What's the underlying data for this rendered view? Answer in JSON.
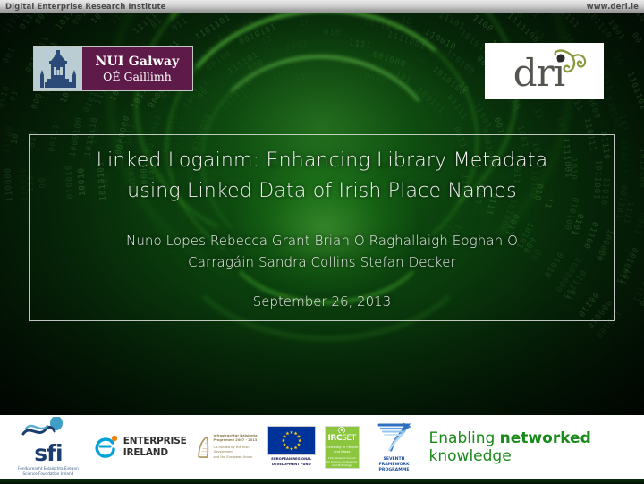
{
  "topbar": {
    "left_text": "Digital Enterprise Research Institute",
    "right_text": "www.deri.ie"
  },
  "logos": {
    "nui_galway": {
      "name": "NUI Galway",
      "line1": "NUI Galway",
      "line2": "OÉ Gaillimh",
      "icon": "quadrangle-tower-icon",
      "crest_bg": "#b9cdd3",
      "wordmark_bg": "#5e1a48"
    },
    "dri": {
      "name": "dri",
      "wordmark": "dri",
      "accent_color": "#8a9a3c"
    }
  },
  "slide": {
    "title_line1": "Linked Logainm: Enhancing Library Metadata",
    "title_line2": "using Linked Data of Irish Place Names",
    "authors": [
      "Nuno Lopes",
      "Rebecca Grant",
      "Brian Ó Raghallaigh",
      "Eoghan Ó Carragáin",
      "Sandra Collins",
      "Stefan Decker"
    ],
    "authors_line1": "Nuno Lopes     Rebecca Grant     Brian Ó Raghallaigh     Eoghan Ó",
    "authors_line2": "Carragáin     Sandra Collins     Stefan Decker",
    "date": "September 26, 2013"
  },
  "footer": {
    "sfi": {
      "wordmark": "sfi",
      "sub_line1": "Fondúireacht Eolaíochta Éireann",
      "sub_line2": "Science Foundation Ireland",
      "color": "#1b3c6e"
    },
    "enterprise_ireland": {
      "line1": "ENTERPRISE",
      "line2": "IRELAND",
      "swirl_color": "#00a3d9",
      "dot_color": "#f0820a"
    },
    "structural_funds": {
      "line1": "Infrastrúchtúr Náisiúnta",
      "line2": "Programme 2007 - 2013",
      "line3": "Co-funded by the Irish Government",
      "line4": "and the European Union",
      "color": "#8a7a4a"
    },
    "european_regional_fund": {
      "caption_line1": "EUROPEAN REGIONAL",
      "caption_line2": "DEVELOPMENT FUND",
      "flag_bg": "#003399",
      "star_color": "#ffcc00"
    },
    "ircset": {
      "wordmark_bold": "IRC",
      "wordmark_light": "SET",
      "tagline": "Investing in People and Ideas",
      "sub_line1": "Irish Research Council",
      "sub_line2": "for Science, Engineering",
      "sub_line3": "and Technology",
      "bg": "#8cc63e"
    },
    "fp7": {
      "caption_line1": "SEVENTH FRAMEWORK",
      "caption_line2": "PROGRAMME",
      "color": "#1b4f9c"
    },
    "tagline": {
      "before": "Enabling ",
      "bold": "networked",
      "after": " knowledge",
      "color": "#1a8a1a"
    }
  }
}
